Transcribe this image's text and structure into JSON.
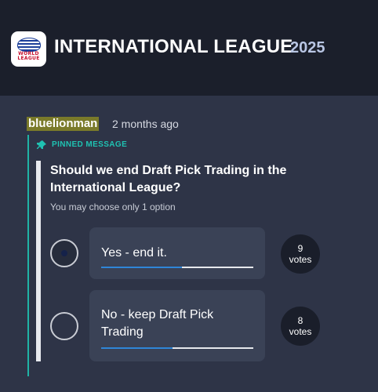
{
  "header": {
    "logo_text": "WORLD LEAGUE",
    "title": "INTERNATIONAL LEAGUE",
    "year": "2025"
  },
  "post": {
    "username": "bluelionman",
    "time_ago": "2 months ago",
    "pinned_label": "PINNED MESSAGE",
    "pin_icon": "pin-icon"
  },
  "poll": {
    "question": "Should we end Draft Pick Trading in the International League?",
    "hint": "You may choose only 1 option",
    "options": [
      {
        "label": "Yes - end it.",
        "votes_count": "9",
        "votes_word": "votes",
        "selected": true,
        "share_percent": 52.9
      },
      {
        "label": "No - keep Draft Pick Trading",
        "votes_count": "8",
        "votes_word": "votes",
        "selected": false,
        "share_percent": 47.1
      }
    ]
  },
  "colors": {
    "accent_teal": "#1fc2b2",
    "progress_blue": "#2f86d8",
    "header_bg": "#1b1f2b",
    "page_bg": "#2e3447",
    "username_highlight": "#7a7a2a"
  }
}
